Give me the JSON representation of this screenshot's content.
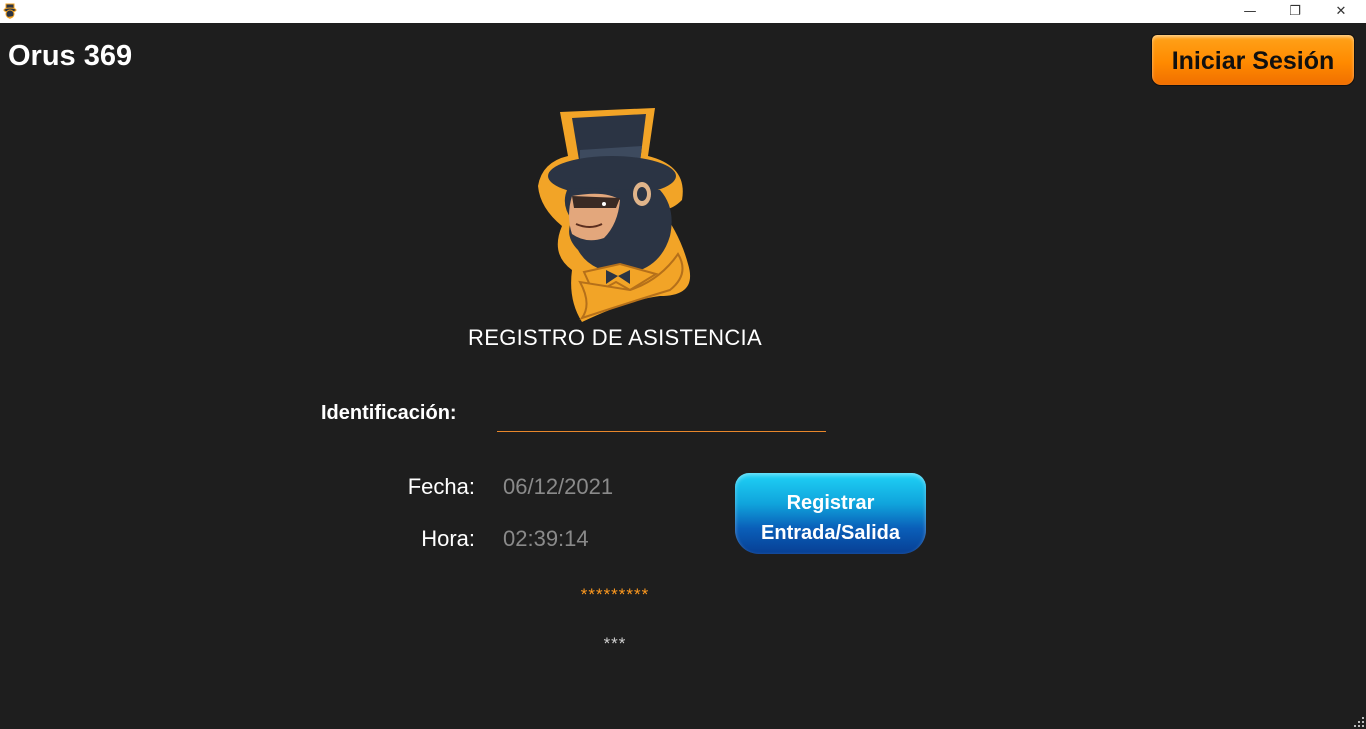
{
  "window": {
    "icon": "gorilla-logo-icon",
    "controls": {
      "minimize": "—",
      "maximize": "❐",
      "close": "✕"
    }
  },
  "header": {
    "app_title": "Orus 369",
    "login_button_label": "Iniciar Sesión"
  },
  "main": {
    "logo": "gorilla-top-hat-logo",
    "heading": "REGISTRO DE  ASISTENCIA",
    "identification_label": "Identificación:",
    "identification_value": "",
    "date_label": "Fecha:",
    "date_value": "06/12/2021",
    "time_label": "Hora:",
    "time_value": "02:39:14",
    "register_button_line1": "Registrar",
    "register_button_line2": "Entrada/Salida",
    "status_primary": "*********",
    "status_secondary": "***"
  },
  "colors": {
    "background": "#1e1e1e",
    "accent_orange": "#ff8a00",
    "accent_blue": "#0a5fb9",
    "input_underline": "#e8872b",
    "muted_text": "#8a8a8a"
  }
}
